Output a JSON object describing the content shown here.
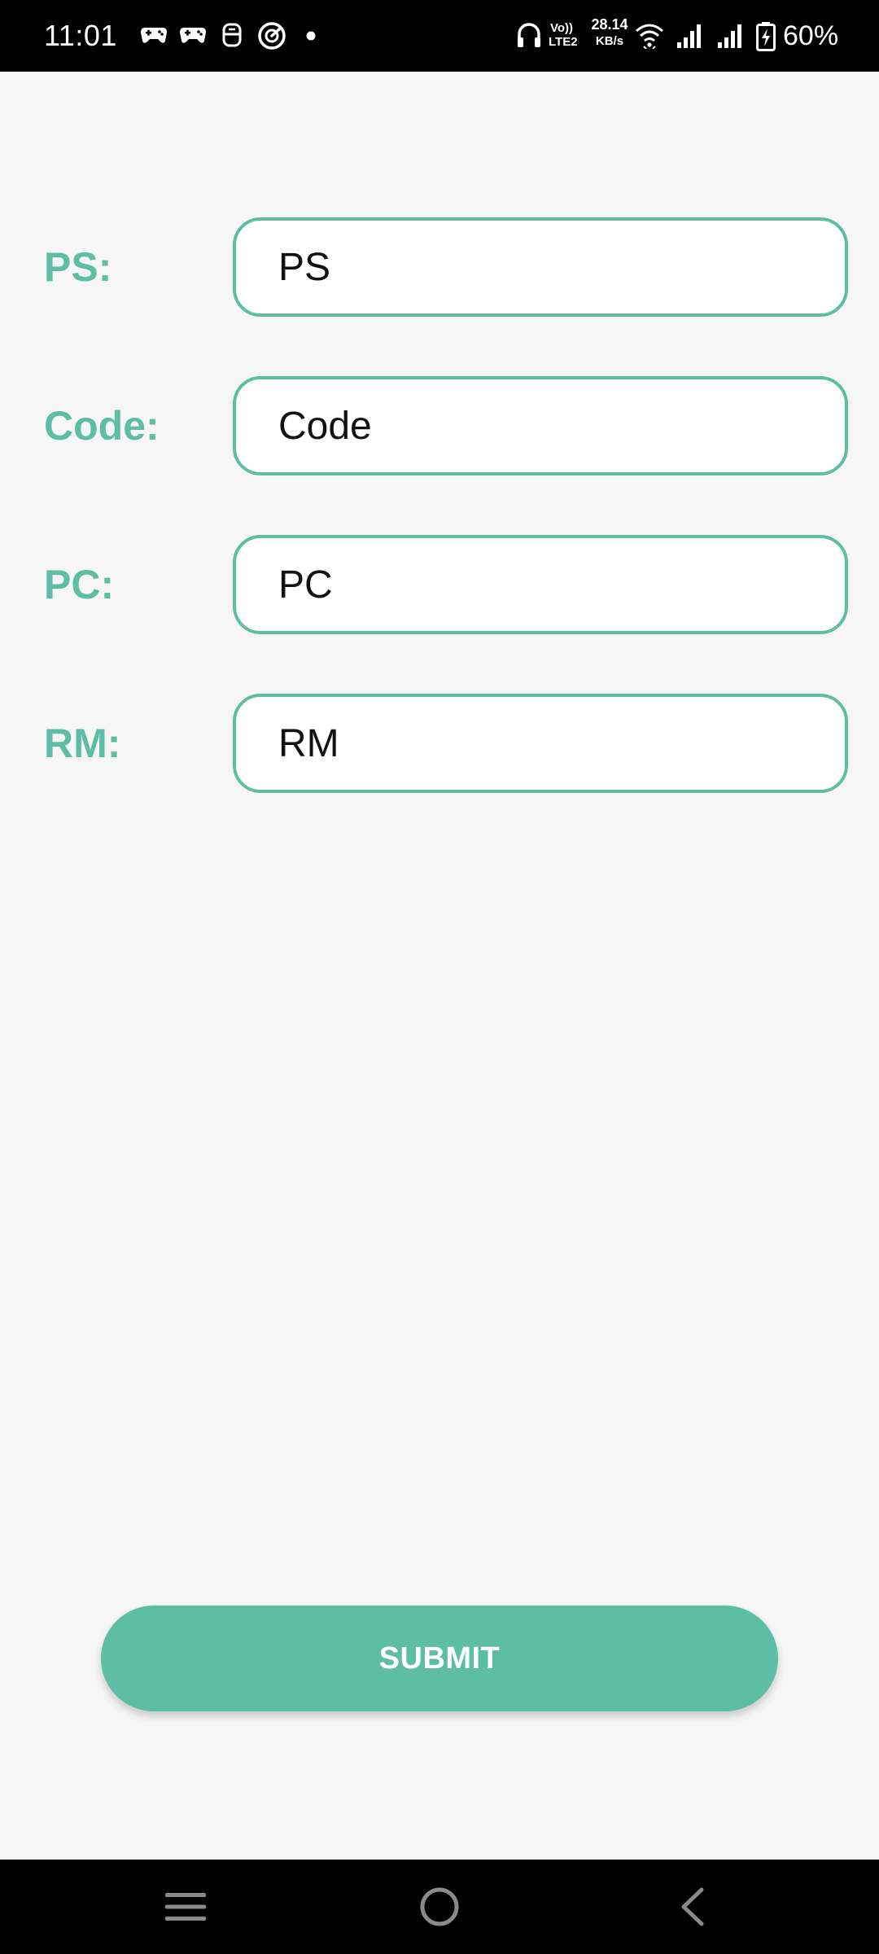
{
  "status_bar": {
    "time": "11:01",
    "network_speed_value": "28.14",
    "network_speed_unit": "KB/s",
    "volte_top": "Vo))",
    "volte_bottom": "LTE2",
    "battery_percent": "60%",
    "icons": [
      "game-controller-icon",
      "game-controller-icon",
      "robot-icon",
      "speedometer-icon",
      "dot-icon",
      "headphones-icon",
      "wifi-icon",
      "signal-icon",
      "signal-icon",
      "battery-charging-icon"
    ]
  },
  "form": {
    "fields": [
      {
        "label": "PS:",
        "placeholder": "PS"
      },
      {
        "label": "Code:",
        "placeholder": "Code"
      },
      {
        "label": "PC:",
        "placeholder": "PC"
      },
      {
        "label": "RM:",
        "placeholder": "RM"
      }
    ],
    "submit_label": "SUBMIT"
  },
  "nav_bar": {
    "icons": [
      "menu-icon",
      "home-icon",
      "back-icon"
    ]
  },
  "colors": {
    "accent": "#5dbea3",
    "background": "#f6f6f6",
    "bar_background": "#000000"
  }
}
